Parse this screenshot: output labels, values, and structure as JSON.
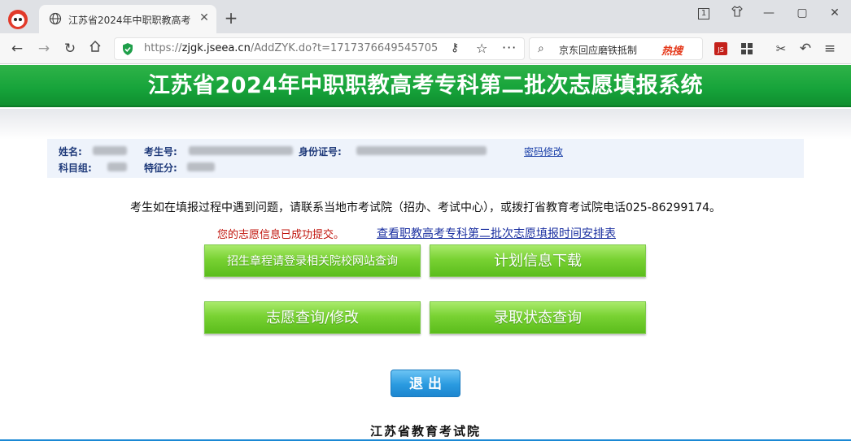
{
  "browser": {
    "tab_title": "江苏省2024年中职职教高考专",
    "url_proto": "https://",
    "url_host": "zjgk.jseea.cn",
    "url_path": "/AddZYK.do?t=1717376649545705",
    "search_suggestion": "京东回应磨铁抵制",
    "search_hot": "热搜",
    "tab_count": "1"
  },
  "page": {
    "banner_title": "江苏省2024年中职职教高考专科第二批次志愿填报系统",
    "info": {
      "name_label": "姓名:",
      "exam_no_label": "考生号:",
      "id_label": "身份证号:",
      "password_link": "密码修改",
      "subject_group_label": "科目组:",
      "bonus_label": "特征分:"
    },
    "notice": "考生如在填报过程中遇到问题，请联系当地市考试院（招办、考试中心），或拨打省教育考试院电话025-86299174。",
    "success_message": "您的志愿信息已成功提交。",
    "schedule_link": "查看职教高考专科第二批次志愿填报时间安排表",
    "buttons": {
      "admission_rules": "招生章程请登录相关院校网站查询",
      "plan_download": "计划信息下载",
      "query_modify": "志愿查询/修改",
      "admission_status": "录取状态查询",
      "logout": "退出"
    },
    "footer": "江苏省教育考试院"
  },
  "colors": {
    "banner_green": "#16a33a",
    "button_green": "#79d233",
    "logout_blue": "#2a9ae0",
    "success_red": "#c0140c",
    "link_blue": "#1a2fa0"
  }
}
